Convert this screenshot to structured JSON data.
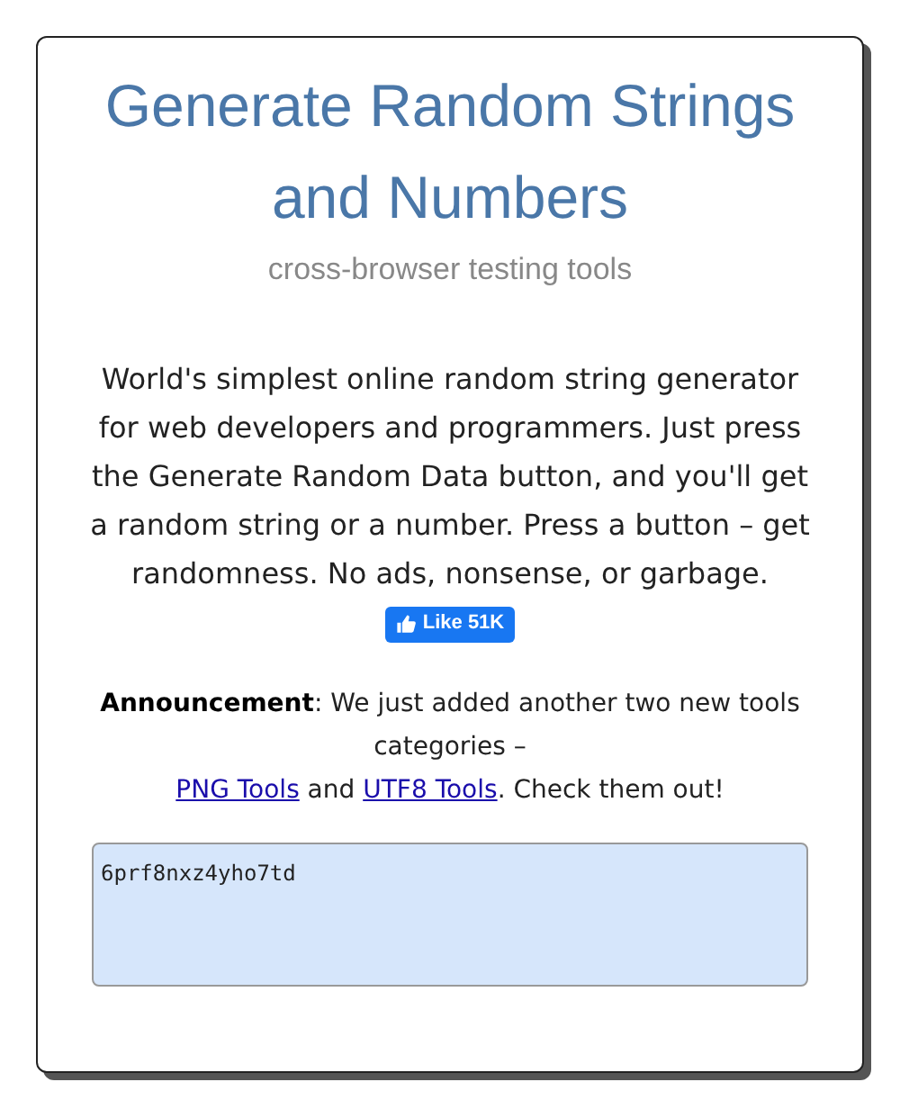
{
  "title": "Generate Random Strings and Numbers",
  "subtitle": "cross-browser testing tools",
  "description": "World's simplest online random string generator for web developers and programmers. Just press the Generate Random Data button, and you'll get a random string or a number. Press a button – get randomness. No ads, nonsense, or garbage.",
  "like_button": {
    "label": "Like 51K"
  },
  "announcement": {
    "label": "Announcement",
    "text": ": We just added another two new tools categories –",
    "links": [
      "PNG Tools",
      "UTF8 Tools"
    ],
    "joiner": " and ",
    "ending": ". Check them out!"
  },
  "output": {
    "value": "6prf8nxz4yho7td"
  }
}
